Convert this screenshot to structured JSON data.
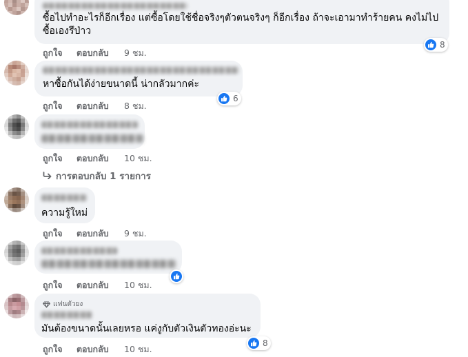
{
  "actions": {
    "like": "ถูกใจ",
    "reply": "ตอบกลับ"
  },
  "comments": [
    {
      "text": "ซื้อไปทำอะไรก็อีกเรื่อง แต่ซื้อโดยใช้ชื่อจริงๆตัวตนจริงๆ ก็อีกเรื่อง ถ้าจะเอามาทำร้ายคน คงไม่ไป\nซื้อเองรึป่าว",
      "time": "9 ชม.",
      "reaction_count": "8"
    },
    {
      "text": "หาซื้อกันได้ง่ายขนาดนี้ น่ากลัวมากค่ะ",
      "time": "8 ชม.",
      "reaction_count": "6"
    },
    {
      "text": "",
      "time": "10 ชม.",
      "replies_label": "การตอบกลับ 1 รายการ"
    },
    {
      "text": "ความรู้ใหม่",
      "time": "9 ชม."
    },
    {
      "text": "",
      "time": "10 ชม."
    },
    {
      "badge": "แฟนตัวยง",
      "text": "มันต้องขนาดนั้นเลยหรอ แค่งูกับตัวเงินตัวทองอ่ะนะ",
      "time": "10 ชม.",
      "reaction_count": "8"
    }
  ],
  "colors": {
    "bubble": "#f0f2f5",
    "like_blue": "#1877f2",
    "meta_gray": "#65676b",
    "text": "#050505"
  },
  "icons": [
    "like-icon",
    "reply-arrow-icon",
    "diamond-icon"
  ]
}
